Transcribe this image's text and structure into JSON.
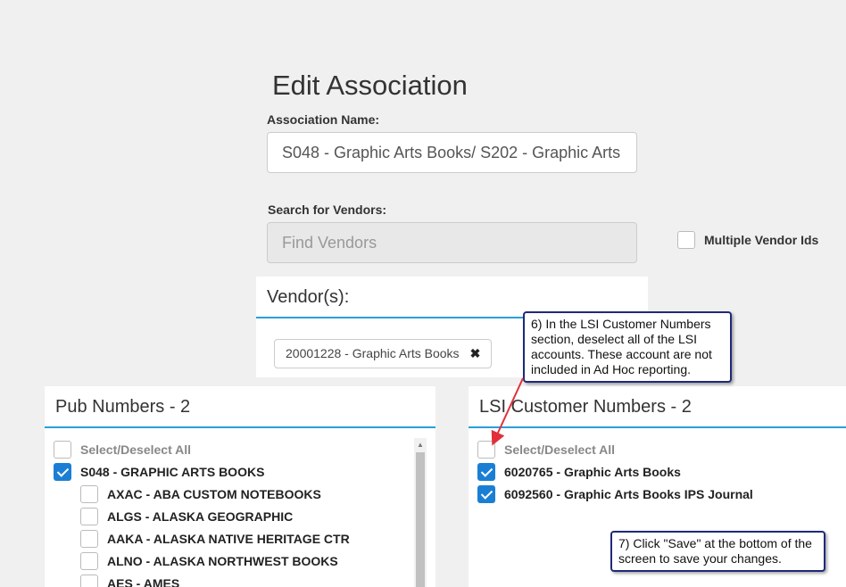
{
  "page": {
    "title": "Edit Association"
  },
  "association": {
    "label": "Association Name:",
    "value": "S048 - Graphic Arts Books/ S202 - Graphic Arts"
  },
  "vendor_search": {
    "label": "Search for Vendors:",
    "placeholder": "Find Vendors"
  },
  "multiple_vendor": {
    "label": "Multiple Vendor Ids",
    "checked": false
  },
  "vendors": {
    "header": "Vendor(s):",
    "chips": [
      {
        "label": "20001228 - Graphic Arts Books",
        "remove_icon": "✖"
      }
    ]
  },
  "pub_numbers": {
    "header": "Pub Numbers - 2",
    "select_all": "Select/Deselect All",
    "items": [
      {
        "label": "S048 - GRAPHIC ARTS BOOKS",
        "checked": true,
        "indent": false
      },
      {
        "label": "AXAC - ABA CUSTOM NOTEBOOKS",
        "checked": false,
        "indent": true
      },
      {
        "label": "ALGS - ALASKA GEOGRAPHIC",
        "checked": false,
        "indent": true
      },
      {
        "label": "AAKA - ALASKA NATIVE HERITAGE CTR",
        "checked": false,
        "indent": true
      },
      {
        "label": "ALNO - ALASKA NORTHWEST BOOKS",
        "checked": false,
        "indent": true
      },
      {
        "label": "AES - AMES",
        "checked": false,
        "indent": true
      }
    ]
  },
  "lsi_numbers": {
    "header": "LSI Customer Numbers - 2",
    "select_all": "Select/Deselect All",
    "items": [
      {
        "label": "6020765 - Graphic Arts Books",
        "checked": true
      },
      {
        "label": "6092560 - Graphic Arts Books IPS Journal",
        "checked": true
      }
    ]
  },
  "callouts": {
    "step6": "6) In the LSI Customer Numbers section, deselect all of the LSI accounts.  These account are not included in Ad Hoc reporting.",
    "step7": "7) Click \"Save\" at the bottom of the screen to save your changes."
  },
  "colors": {
    "accent": "#2a9fd8",
    "checkbox": "#1a7fd4",
    "callout_border": "#1f2a7a",
    "arrow": "#e0303a"
  }
}
